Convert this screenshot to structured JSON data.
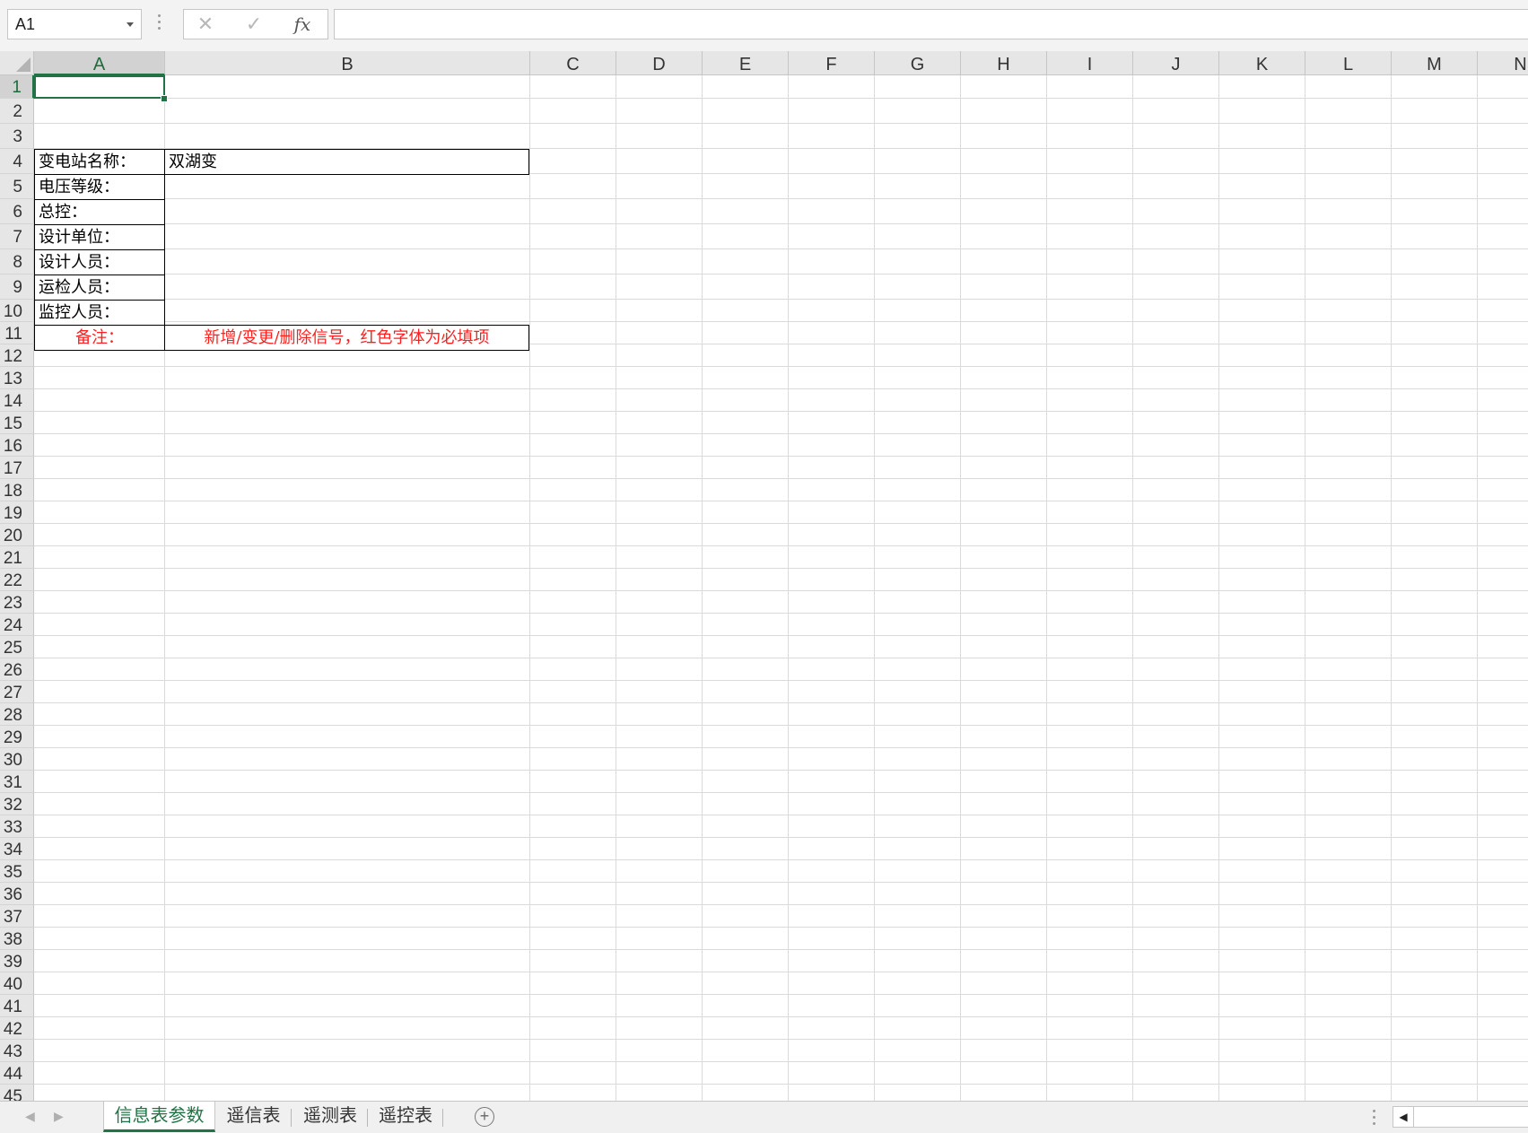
{
  "formula_bar": {
    "name_box": "A1",
    "cancel_glyph": "✕",
    "enter_glyph": "✓",
    "fx_label": "fx",
    "formula": ""
  },
  "columns": [
    "A",
    "B",
    "C",
    "D",
    "E",
    "F",
    "G",
    "H",
    "I",
    "J",
    "K",
    "L",
    "M",
    "N"
  ],
  "rows": [
    "1",
    "2",
    "3",
    "4",
    "5",
    "6",
    "7",
    "8",
    "9",
    "10",
    "11",
    "12",
    "13",
    "14",
    "15",
    "16",
    "17",
    "18",
    "19",
    "20",
    "21",
    "22",
    "23",
    "24",
    "25",
    "26",
    "27",
    "28",
    "29",
    "30",
    "31",
    "32",
    "33",
    "34",
    "35",
    "36",
    "37",
    "38",
    "39",
    "40",
    "41",
    "42",
    "43",
    "44",
    "45"
  ],
  "selected_cell": {
    "column": "A",
    "row": "1"
  },
  "cells": {
    "A2": "变电站名称：",
    "B2": "双湖变",
    "A3": "电压等级：",
    "B3": "",
    "A4": "总控：",
    "B4": "",
    "A5": "设计单位：",
    "B5": "",
    "A6": "设计人员：",
    "B6": "",
    "A7": "运检人员：",
    "B7": "",
    "A8": "监控人员：",
    "B8": "",
    "A9": "备注：",
    "B9": "新增/变更/删除信号，红色字体为必填项"
  },
  "colors": {
    "accent": "#217346",
    "note_red": "#ff1f1f"
  },
  "sheet_tabs": [
    {
      "label": "信息表参数",
      "active": true
    },
    {
      "label": "遥信表",
      "active": false
    },
    {
      "label": "遥测表",
      "active": false
    },
    {
      "label": "遥控表",
      "active": false
    }
  ],
  "add_sheet_glyph": "+",
  "icons": [
    "dropdown-arrow-icon",
    "cancel-icon",
    "enter-icon",
    "function-icon",
    "add-sheet-icon",
    "scroll-left-icon"
  ]
}
